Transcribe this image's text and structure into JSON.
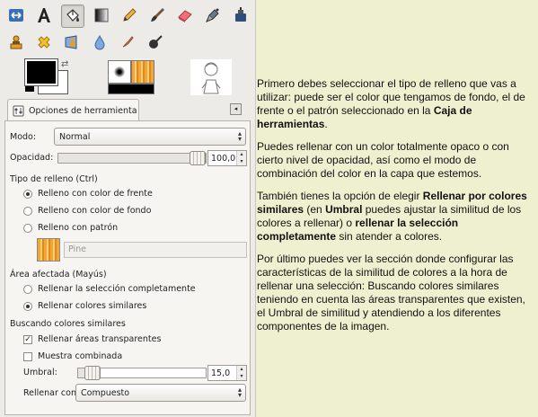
{
  "toolbox": {
    "tools_row1": [
      "move-icon",
      "text-tool-icon",
      "bucket-fill-icon",
      "blend-icon",
      "pencil-icon",
      "paintbrush-icon",
      "eraser-icon",
      "airbrush-icon",
      "ink-icon"
    ],
    "tools_row2": [
      "clone-icon",
      "heal-icon",
      "perspective-clone-icon",
      "blur-icon",
      "smudge-icon",
      "dodge-burn-icon"
    ],
    "active_tool": "bucket-fill-icon",
    "fg_color": "#000000",
    "bg_color": "#ffffff"
  },
  "tab": {
    "label": "Opciones de herramienta"
  },
  "options": {
    "mode_label": "Modo:",
    "mode_value": "Normal",
    "opacity_label": "Opacidad:",
    "opacity_value": "100,0",
    "opacity_fraction": 1.0,
    "fill_type_label": "Tipo de relleno  (Ctrl)",
    "fill_types": [
      {
        "label": "Relleno con color de frente",
        "selected": true
      },
      {
        "label": "Relleno con color de fondo",
        "selected": false
      },
      {
        "label": "Relleno con patrón",
        "selected": false
      }
    ],
    "pattern_name": "Pine",
    "area_label": "Área afectada  (Mayús)",
    "areas": [
      {
        "label": "Rellenar la selección completamente",
        "selected": false
      },
      {
        "label": "Rellenar colores similares",
        "selected": true
      }
    ],
    "similar_label": "Buscando colores similares",
    "transparent_label": "Rellenar áreas transparentes",
    "transparent_checked": true,
    "merged_label": "Muestra combinada",
    "merged_checked": false,
    "threshold_label": "Umbral:",
    "threshold_value": "15,0",
    "threshold_fraction": 0.06,
    "fill_by_label": "Rellenar con:",
    "fill_by_value": "Compuesto"
  },
  "explanation": {
    "p1_a": "Primero debes seleccionar el tipo de relleno que vas a utilizar: puede ser el color que tengamos de fondo, el de frente o el patrón seleccionado en la ",
    "p1_b": "Caja de herramientas",
    "p1_c": ".",
    "p2": "Puedes rellenar con un color totalmente opaco o con cierto nivel de opacidad, así como el modo de combinación del color en la capa que estemos.",
    "p3_a": "También tienes la opción de elegir ",
    "p3_b": "Rellenar por colores similares",
    "p3_c": " (en ",
    "p3_d": "Umbral",
    "p3_e": " puedes ajustar la similitud de los colores a rellenar) o ",
    "p3_f": "rellenar la selección completamente",
    "p3_g": " sin atender a colores.",
    "p4": "Por último puedes ver la sección donde configurar las características de la similitud de colores a la hora de rellenar una selección: Buscando colores similares teniendo en cuenta las áreas transparentes que existen, el Umbral de similitud y atendiendo a los diferentes componentes de la imagen."
  }
}
